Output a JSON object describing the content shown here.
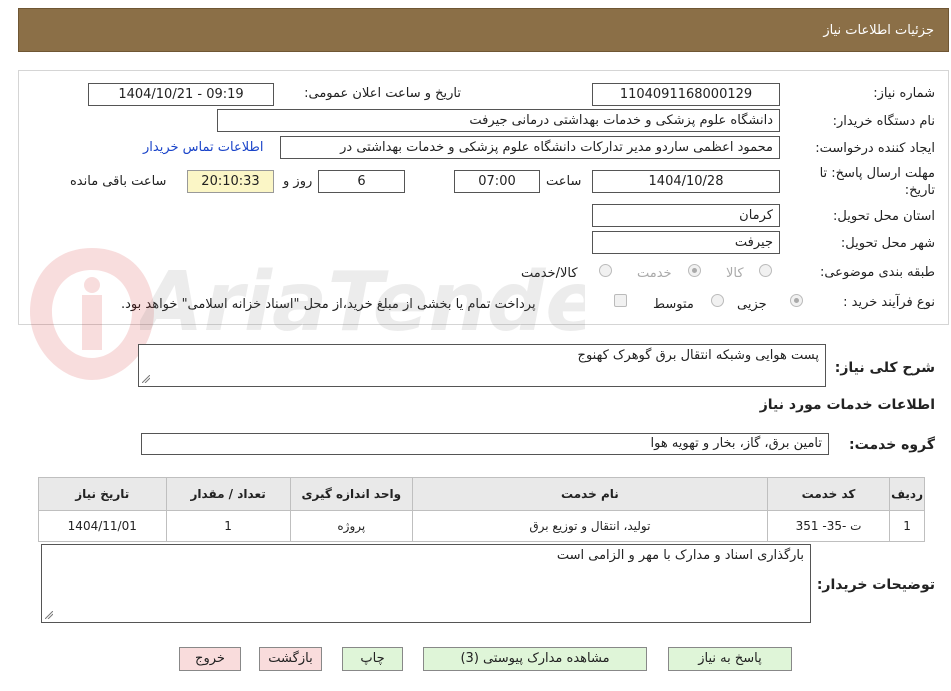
{
  "header": {
    "title": "جزئیات اطلاعات نیاز"
  },
  "form": {
    "need_number": {
      "label": "شماره نیاز:",
      "value": "1104091168000129"
    },
    "announce": {
      "label": "تاریخ و ساعت اعلان عمومی:",
      "value": "1404/10/21 - 09:19"
    },
    "buyer_org": {
      "label": "نام دستگاه خریدار:",
      "value": "دانشگاه علوم پزشکی و خدمات بهداشتی درمانی جیرفت"
    },
    "requester": {
      "label": "ایجاد کننده درخواست:",
      "value": "محمود اعظمی ساردو مدیر تدارکات دانشگاه علوم پزشکی و خدمات بهداشتی در",
      "contact_link": "اطلاعات تماس خریدار"
    },
    "deadline": {
      "label_line1": "مهلت ارسال پاسخ: تا",
      "label_line2": "تاریخ:",
      "date": "1404/10/28",
      "time_label": "ساعت",
      "time": "07:00",
      "days": "6",
      "days_label": "روز و",
      "remaining": "20:10:33",
      "remaining_label": "ساعت باقی مانده"
    },
    "province": {
      "label": "استان محل تحویل:",
      "value": "کرمان"
    },
    "city": {
      "label": "شهر محل تحویل:",
      "value": "جیرفت"
    },
    "category": {
      "label": "طبقه بندی موضوعی:",
      "options": [
        "کالا",
        "خدمت",
        "کالا/خدمت"
      ],
      "selected": "خدمت"
    },
    "process": {
      "label": "نوع فرآیند خرید :",
      "options": [
        "جزیی",
        "متوسط"
      ],
      "selected": "جزیی",
      "payment_note": "پرداخت تمام یا بخشی از مبلغ خرید،از محل \"اسناد خزانه اسلامی\" خواهد بود."
    }
  },
  "description": {
    "label": "شرح کلی نیاز:",
    "value": "پست هوایی وشبکه انتقال برق گوهرک کهنوج"
  },
  "services_section": {
    "title": "اطلاعات خدمات مورد نیاز",
    "group_label": "گروه خدمت:",
    "group_value": "تامین برق، گاز، بخار و تهویه هوا"
  },
  "table": {
    "headers": [
      "ردیف",
      "کد خدمت",
      "نام خدمت",
      "واحد اندازه گیری",
      "تعداد / مقدار",
      "تاریخ نیاز"
    ],
    "rows": [
      [
        "1",
        "ت -35- 351",
        "تولید، انتقال و توزیع برق",
        "پروژه",
        "1",
        "1404/11/01"
      ]
    ]
  },
  "buyer_notes": {
    "label": "توضیحات خریدار:",
    "value": "بارگذاری اسناد و مدارک با مهر و الزامی است"
  },
  "buttons": {
    "reply": "پاسخ به نیاز",
    "attachments": "مشاهده مدارک پیوستی (3)",
    "print": "چاپ",
    "back": "بازگشت",
    "exit": "خروج"
  },
  "watermark": {
    "text": "AriaTender.neT"
  },
  "colors": {
    "header_bg": "#8b6f47",
    "link": "#1a44c9",
    "remaining_bg": "#fbf6c6",
    "green_button": "#dff5d8",
    "pink_button": "#f9dcdc"
  }
}
